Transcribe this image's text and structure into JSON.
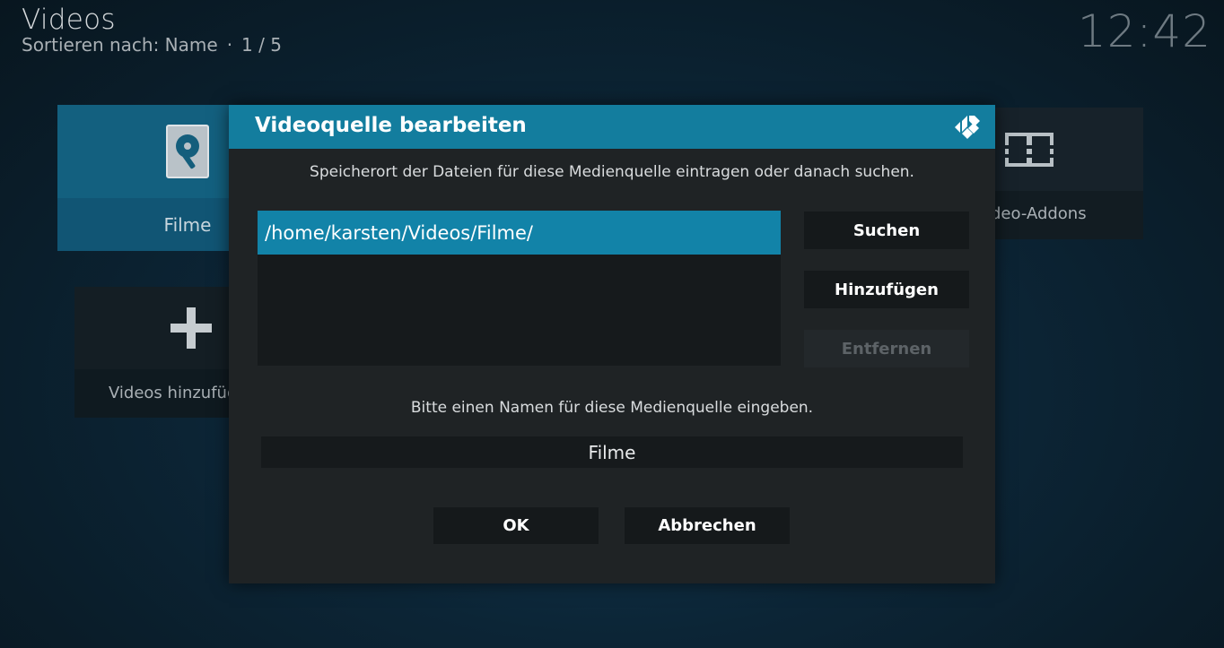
{
  "header": {
    "title": "Videos",
    "sort_label": "Sortieren nach: Name",
    "separator": "·",
    "page": "1 / 5",
    "clock": "12:42"
  },
  "tiles": {
    "filme": {
      "label": "Filme",
      "icon": "hard-drive-icon"
    },
    "add_videos": {
      "label": "Videos hinzufüg",
      "icon": "plus-icon"
    },
    "video_addons": {
      "label": "deo-Addons",
      "icon": "film-strip-icon"
    }
  },
  "dialog": {
    "title": "Videoquelle bearbeiten",
    "logo_icon": "kodi-logo-icon",
    "path_instruction": "Speicherort der Dateien für diese Medienquelle eintragen oder danach suchen.",
    "paths": [
      "/home/karsten/Videos/Filme/"
    ],
    "buttons": {
      "search": "Suchen",
      "add": "Hinzufügen",
      "remove": "Entfernen"
    },
    "name_instruction": "Bitte einen Namen für diese Medienquelle eingeben.",
    "name_value": "Filme",
    "ok": "OK",
    "cancel": "Abbrechen"
  },
  "colors": {
    "accent": "#137d9e",
    "selected_item": "#1283a8",
    "dialog_bg": "#1f2325"
  }
}
